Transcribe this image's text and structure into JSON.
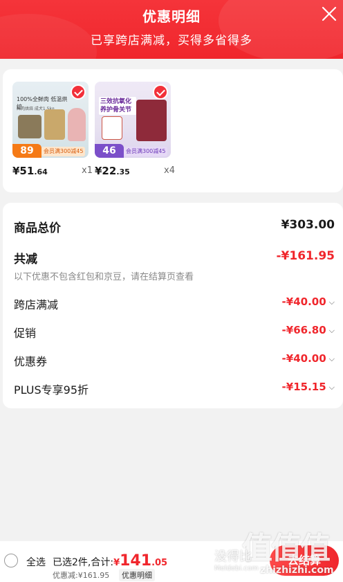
{
  "header": {
    "title": "优惠明细",
    "subtitle": "已享跨店满减，买得多省得多"
  },
  "products": [
    {
      "price_main": "¥51",
      "price_decimal": ".64",
      "quantity": "x1",
      "badge_price": "89",
      "badge_promo": "会员满300减45",
      "image_text": "100%全鲜肉 低温烘焙",
      "image_subtext": "鲜肉烘焙 成犬1.5kg"
    },
    {
      "price_main": "¥22",
      "price_decimal": ".35",
      "quantity": "x4",
      "badge_price": "46",
      "badge_promo": "会员满300减45",
      "image_text": "三效抗氧化 养护骨关节"
    }
  ],
  "totals": {
    "goods_total_label": "商品总价",
    "goods_total_value": "¥303.00",
    "reduction_label": "共减",
    "reduction_value": "-¥161.95",
    "note": "以下优惠不包含红包和京豆，请在结算页查看",
    "items": [
      {
        "label": "跨店满减",
        "value": "-¥40.00"
      },
      {
        "label": "促销",
        "value": "-¥66.80"
      },
      {
        "label": "优惠券",
        "value": "-¥40.00"
      },
      {
        "label": "PLUS专享95折",
        "value": "-¥15.15"
      }
    ]
  },
  "footer": {
    "select_all": "全选",
    "selected_text": "已选2件,合计:",
    "total_yen": "¥",
    "total_int": "141",
    "total_dec": ".05",
    "discount_text": "优惠减:¥161.95",
    "detail_link": "优惠明细",
    "checkout": "去结算"
  },
  "watermark": {
    "big": "值值值",
    "small": "没得比",
    "domain": "zhizhizhi.com",
    "meldebi": "Meldebi.com"
  },
  "colors": {
    "accent": "#f0262c",
    "header_bg": "#f5343a"
  }
}
